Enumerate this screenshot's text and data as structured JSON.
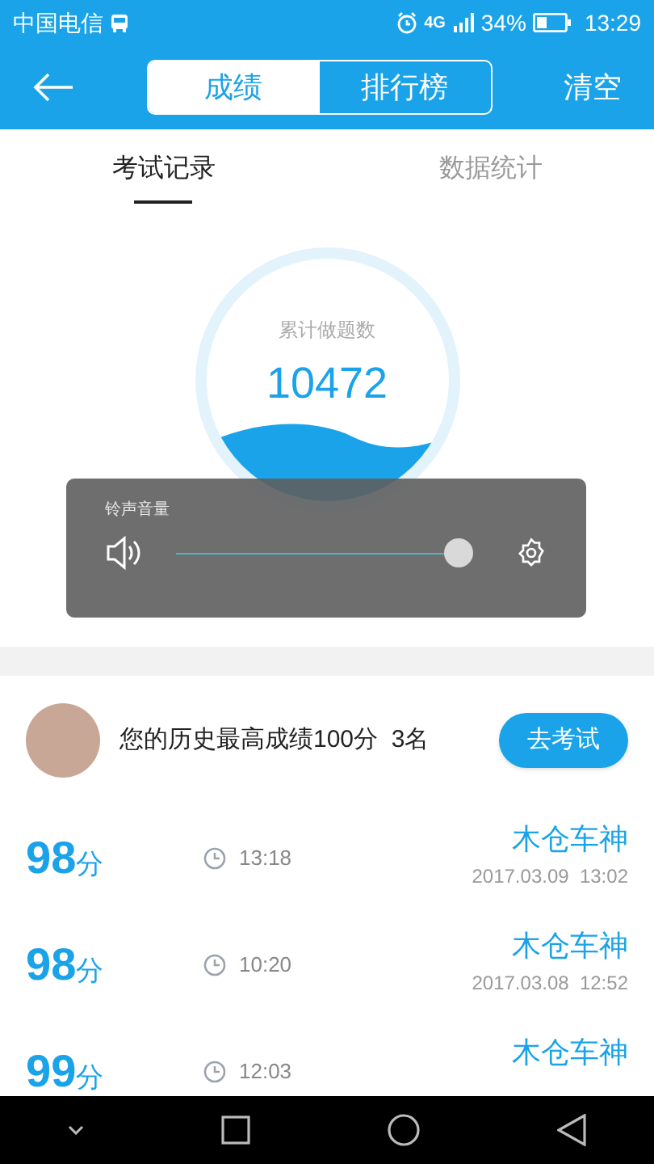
{
  "status_bar": {
    "carrier": "中国电信",
    "signal_label": "4G",
    "battery": "34%",
    "time": "13:29"
  },
  "header": {
    "segments": [
      {
        "label": "成绩",
        "selected": true
      },
      {
        "label": "排行榜",
        "selected": false
      }
    ],
    "action": "清空"
  },
  "tabs": [
    {
      "label": "考试记录",
      "selected": true
    },
    {
      "label": "数据统计",
      "selected": false
    }
  ],
  "summary": {
    "caption": "累计做题数",
    "value": "10472"
  },
  "volume": {
    "title": "铃声音量",
    "level": 0.97
  },
  "best": {
    "text": "您的历史最高成绩100分  3名",
    "button": "去考试"
  },
  "records": [
    {
      "score": "98",
      "unit": "分",
      "duration": "13:18",
      "name": "木仓车神",
      "date": "2017.03.09  13:02"
    },
    {
      "score": "98",
      "unit": "分",
      "duration": "10:20",
      "name": "木仓车神",
      "date": "2017.03.08  12:52"
    },
    {
      "score": "99",
      "unit": "分",
      "duration": "12:03",
      "name": "木仓车神"
    }
  ]
}
